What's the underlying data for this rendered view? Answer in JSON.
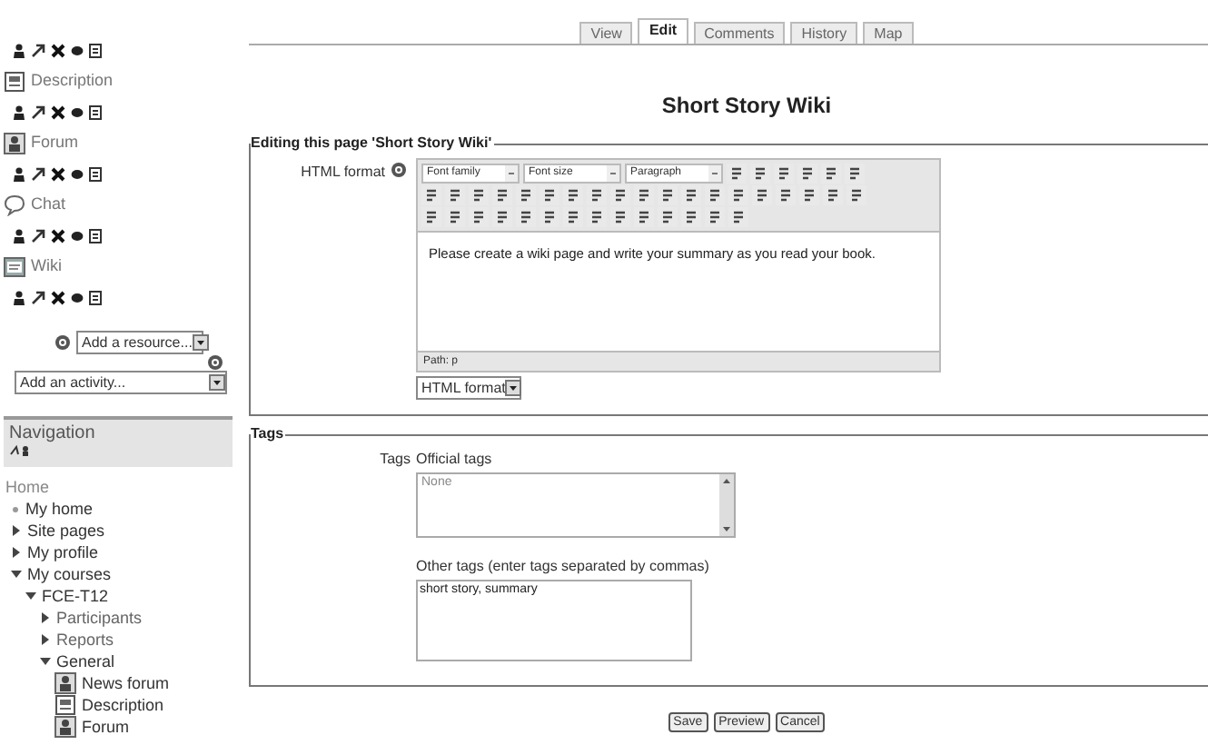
{
  "sidebar": {
    "items": [
      {
        "kind": "edit_controls"
      },
      {
        "kind": "description",
        "label": "Description"
      },
      {
        "kind": "edit_controls"
      },
      {
        "kind": "forum",
        "label": "Forum"
      },
      {
        "kind": "edit_controls"
      },
      {
        "kind": "chat",
        "label": "Chat"
      },
      {
        "kind": "edit_controls"
      },
      {
        "kind": "wiki",
        "label": "Wiki"
      },
      {
        "kind": "edit_controls"
      }
    ],
    "add_resource": "Add a resource...",
    "add_activity": "Add an activity..."
  },
  "navigation": {
    "title": "Navigation",
    "home": "Home",
    "items": [
      {
        "label": "My home",
        "kind": "leaf"
      },
      {
        "label": "Site pages",
        "kind": "branch",
        "expanded": false
      },
      {
        "label": "My profile",
        "kind": "branch",
        "expanded": false
      },
      {
        "label": "My courses",
        "kind": "branch",
        "expanded": true,
        "children": [
          {
            "label": "FCE-T12",
            "kind": "branch",
            "expanded": true,
            "children": [
              {
                "label": "Participants",
                "kind": "branch",
                "expanded": false
              },
              {
                "label": "Reports",
                "kind": "branch",
                "expanded": false
              },
              {
                "label": "General",
                "kind": "branch",
                "expanded": true,
                "children": [
                  {
                    "label": "News forum",
                    "kind": "forum"
                  },
                  {
                    "label": "Description",
                    "kind": "description"
                  },
                  {
                    "label": "Forum",
                    "kind": "forum"
                  }
                ]
              }
            ]
          }
        ]
      }
    ]
  },
  "tabs": [
    {
      "label": "View",
      "selected": false
    },
    {
      "label": "Edit",
      "selected": true
    },
    {
      "label": "Comments",
      "selected": false
    },
    {
      "label": "History",
      "selected": false
    },
    {
      "label": "Map",
      "selected": false
    }
  ],
  "title": "Short Story Wiki",
  "editing": {
    "legend": "Editing this page 'Short Story Wiki'",
    "label": "HTML format",
    "font_family": "Font family",
    "font_size": "Font size",
    "paragraph": "Paragraph",
    "content": "Please create a wiki page and write your summary as you read your book.",
    "path": "Path: p",
    "format": "HTML format"
  },
  "tags": {
    "legend": "Tags",
    "label": "Tags",
    "official_label": "Official tags",
    "official_value": "None",
    "other_label": "Other tags (enter tags separated by commas)",
    "other_value": "short story, summary"
  },
  "buttons": [
    "Save",
    "Preview",
    "Cancel"
  ]
}
